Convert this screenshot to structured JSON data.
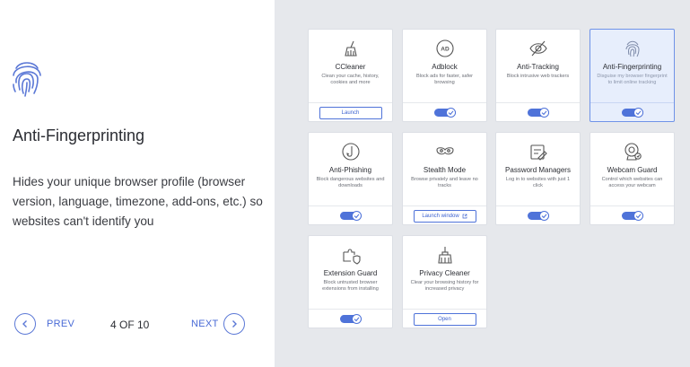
{
  "feature": {
    "icon": "fingerprint-icon",
    "title": "Anti-Fingerprinting",
    "description": "Hides your unique browser profile (browser version, language, timezone, add-ons, etc.) so websites can't identify you"
  },
  "pager": {
    "prev_label": "PREV",
    "indicator": "4 OF 10",
    "next_label": "NEXT"
  },
  "colors": {
    "accent": "#4f73d9",
    "selected_bg": "#e7eefc",
    "panel_bg": "#e6e8ec"
  },
  "cards": [
    {
      "title": "CCleaner",
      "desc": "Clean your cache, history, cookies and more",
      "icon": "broom-icon",
      "action": "button",
      "action_label": "Launch"
    },
    {
      "title": "Adblock",
      "desc": "Block ads for faster, safer browsing",
      "icon": "ad-icon",
      "action": "toggle",
      "enabled": true
    },
    {
      "title": "Anti-Tracking",
      "desc": "Block intrusive web trackers",
      "icon": "eye-slash-icon",
      "action": "toggle",
      "enabled": true
    },
    {
      "title": "Anti-Fingerprinting",
      "desc": "Disguise my browser fingerprint to limit online tracking",
      "icon": "fingerprint-icon",
      "action": "toggle",
      "enabled": true,
      "selected": true
    },
    {
      "title": "Anti-Phishing",
      "desc": "Block dangerous websites and downloads",
      "icon": "hook-icon",
      "action": "toggle",
      "enabled": true
    },
    {
      "title": "Stealth Mode",
      "desc": "Browse privately and leave no tracks",
      "icon": "mask-icon",
      "action": "button",
      "action_label": "Launch window"
    },
    {
      "title": "Password Managers",
      "desc": "Log in to websites with just 1 click",
      "icon": "password-form-icon",
      "action": "toggle",
      "enabled": true
    },
    {
      "title": "Webcam Guard",
      "desc": "Control which websites can access your webcam",
      "icon": "webcam-icon",
      "action": "toggle",
      "enabled": true
    },
    {
      "title": "Extension Guard",
      "desc": "Block untrusted browser extensions from installing",
      "icon": "puzzle-shield-icon",
      "action": "toggle",
      "enabled": true
    },
    {
      "title": "Privacy Cleaner",
      "desc": "Clear your browsing history for increased privacy",
      "icon": "cleaner-icon",
      "action": "button",
      "action_label": "Open"
    }
  ]
}
